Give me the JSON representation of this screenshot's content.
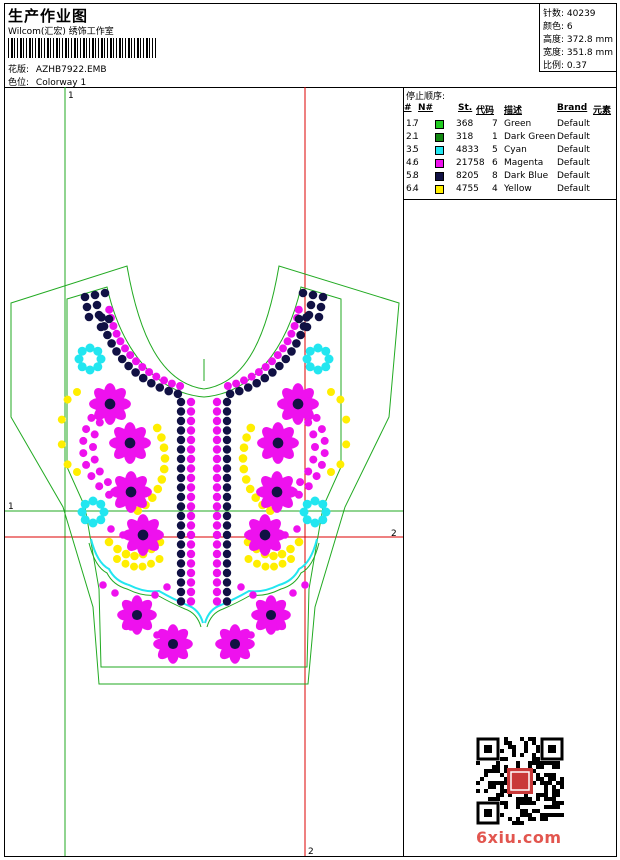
{
  "header": {
    "title": "生产作业图",
    "company": "Wilcom(汇宏) 绣饰工作室",
    "design_label": "花版:",
    "design_value": "AZHB7922.EMB",
    "colorway_label": "色位:",
    "colorway_value": "Colorway 1"
  },
  "stats": {
    "stitches": "针数: 40239",
    "colors": "颜色: 6",
    "height": "高度: 372.8 mm",
    "width": "宽度: 351.8 mm",
    "scale": "比例: 0.37"
  },
  "stop_sequence": {
    "title": "停止顺序:",
    "columns": [
      "#",
      "N#",
      "St.",
      "代码",
      "描述",
      "Brand",
      "元素"
    ],
    "rows": [
      {
        "idx": "1.",
        "n": "7",
        "color": "#22cc22",
        "stitches": "368",
        "code": "7",
        "desc": "Green",
        "brand": "Default"
      },
      {
        "idx": "2.",
        "n": "1",
        "color": "#118811",
        "stitches": "318",
        "code": "1",
        "desc": "Dark Green",
        "brand": "Default"
      },
      {
        "idx": "3.",
        "n": "5",
        "color": "#22e6f0",
        "stitches": "4833",
        "code": "5",
        "desc": "Cyan",
        "brand": "Default"
      },
      {
        "idx": "4.",
        "n": "6",
        "color": "#ee11ee",
        "stitches": "21758",
        "code": "6",
        "desc": "Magenta",
        "brand": "Default"
      },
      {
        "idx": "5.",
        "n": "8",
        "color": "#111144",
        "stitches": "8205",
        "code": "8",
        "desc": "Dark Blue",
        "brand": "Default"
      },
      {
        "idx": "6.",
        "n": "4",
        "color": "#ffee00",
        "stitches": "4755",
        "code": "4",
        "desc": "Yellow",
        "brand": "Default"
      }
    ]
  },
  "guides": {
    "v1": "1",
    "h1": "1",
    "h2": "2",
    "v2": "2"
  },
  "colors": {
    "magenta": "#ee11ee",
    "navy": "#111144",
    "cyan": "#22e6f0",
    "yellow": "#ffee00",
    "green": "#22aa22",
    "red": "#dd0000"
  },
  "watermark": {
    "text": "6xiu.com"
  }
}
